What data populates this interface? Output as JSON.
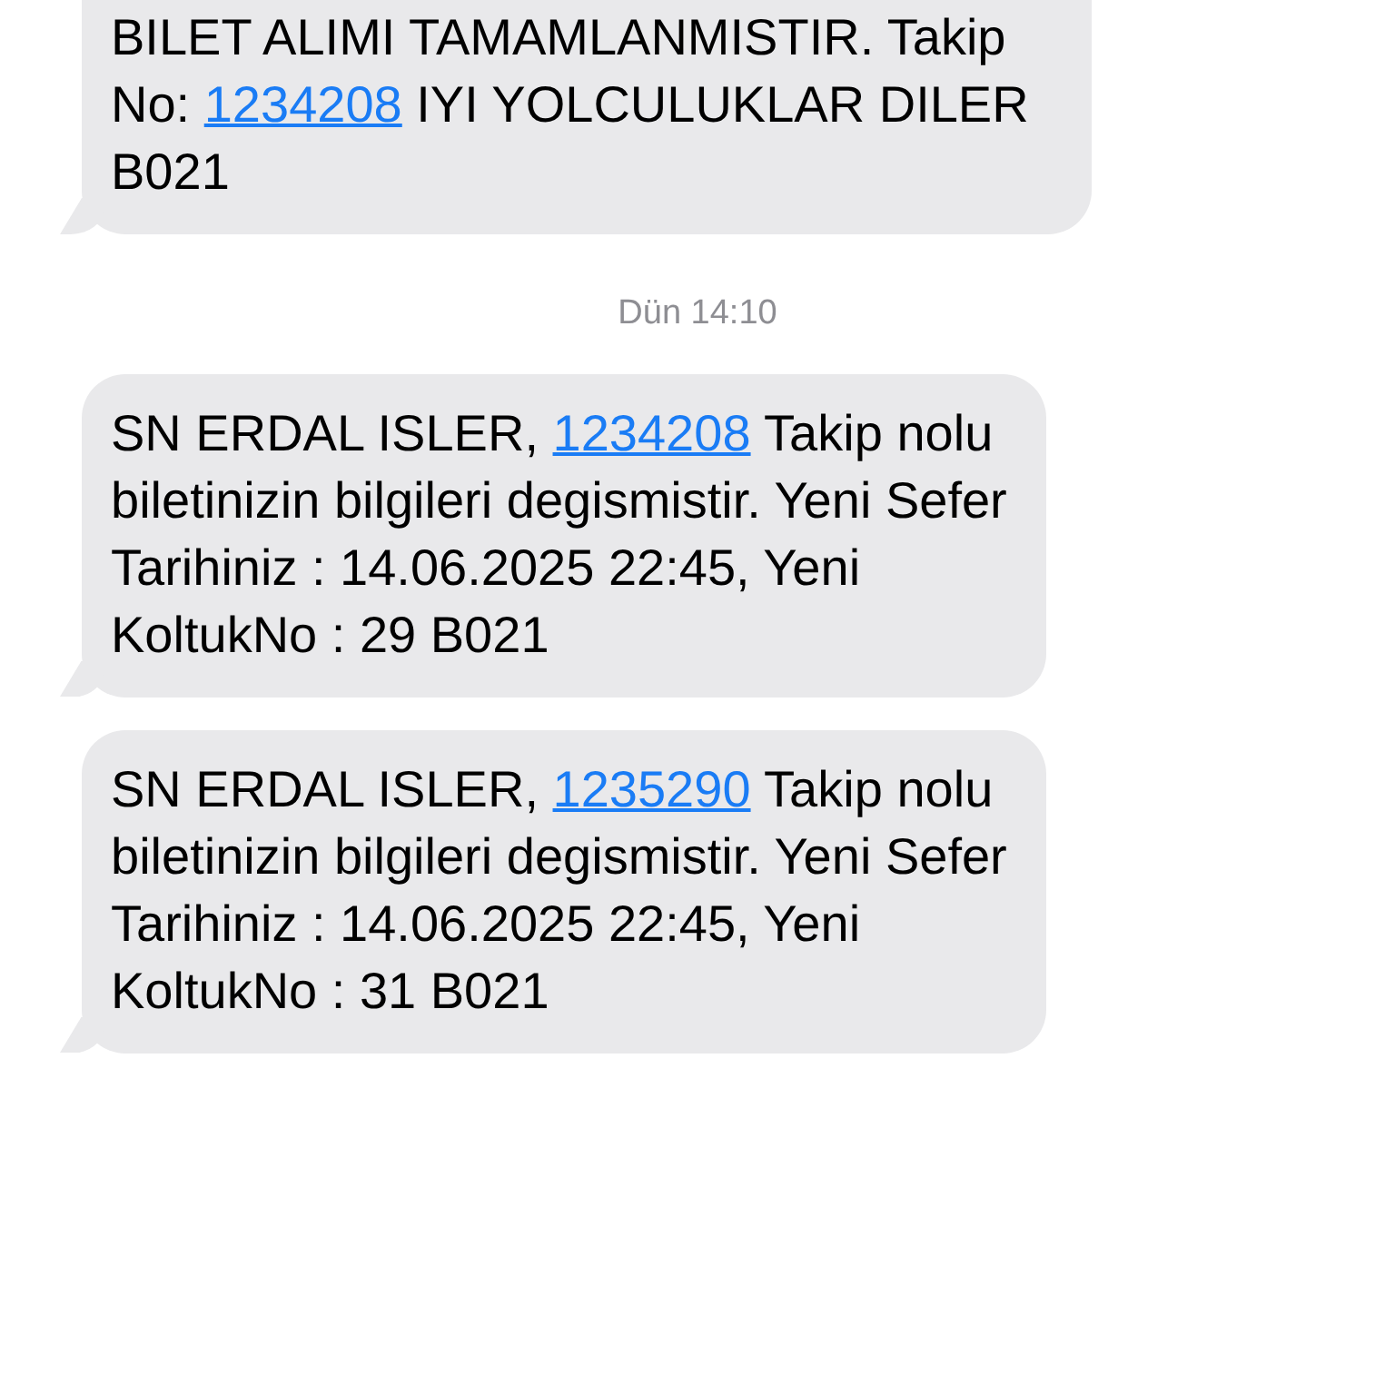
{
  "messages": [
    {
      "kind": "message",
      "parts": [
        {
          "kind": "text",
          "text": "BILET ALIMI TAMAMLANMISTIR. Takip No: "
        },
        {
          "kind": "link",
          "text": "1234208"
        },
        {
          "kind": "text",
          "text": " IYI YOLCULUKLAR DILER B021"
        }
      ]
    },
    {
      "kind": "timestamp",
      "text": "Dün 14:10"
    },
    {
      "kind": "message",
      "parts": [
        {
          "kind": "text",
          "text": "SN ERDAL ISLER, "
        },
        {
          "kind": "link",
          "text": "1234208"
        },
        {
          "kind": "text",
          "text": " Takip nolu biletinizin bilgileri degismistir. Yeni Sefer Tarihiniz : 14.06.2025 22:45, Yeni KoltukNo : 29 B021"
        }
      ]
    },
    {
      "kind": "message",
      "parts": [
        {
          "kind": "text",
          "text": "SN ERDAL ISLER, "
        },
        {
          "kind": "link",
          "text": "1235290"
        },
        {
          "kind": "text",
          "text": " Takip nolu biletinizin bilgileri degismistir. Yeni Sefer Tarihiniz : 14.06.2025 22:45, Yeni KoltukNo : 31 B021"
        }
      ]
    }
  ]
}
